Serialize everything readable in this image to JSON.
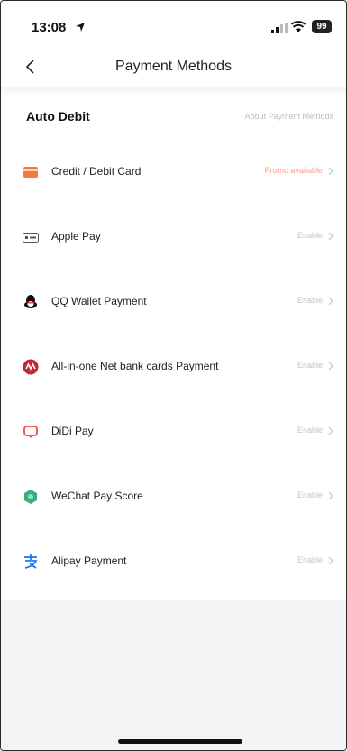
{
  "status_bar": {
    "time": "13:08",
    "battery": "99"
  },
  "nav": {
    "title": "Payment Methods"
  },
  "section": {
    "title": "Auto Debit",
    "link": "About Payment Methods"
  },
  "methods": [
    {
      "label": "Credit / Debit Card",
      "action": "Promo available",
      "icon": "credit-card-icon",
      "color": "#f47a3c"
    },
    {
      "label": "Apple Pay",
      "action": "Enable",
      "icon": "apple-pay-icon",
      "color": "#555555"
    },
    {
      "label": "QQ Wallet Payment",
      "action": "Enable",
      "icon": "qq-penguin-icon",
      "color": "#111111"
    },
    {
      "label": "All-in-one Net bank cards Payment",
      "action": "Enable",
      "icon": "netbank-icon",
      "color": "#c0283a"
    },
    {
      "label": "DiDi Pay",
      "action": "Enable",
      "icon": "didi-pay-icon",
      "color": "#f05a5a"
    },
    {
      "label": "WeChat Pay Score",
      "action": "Enable",
      "icon": "wechat-pay-score-icon",
      "color": "#39b07a"
    },
    {
      "label": "Alipay Payment",
      "action": "Enable",
      "icon": "alipay-icon",
      "color": "#1677ff"
    }
  ]
}
